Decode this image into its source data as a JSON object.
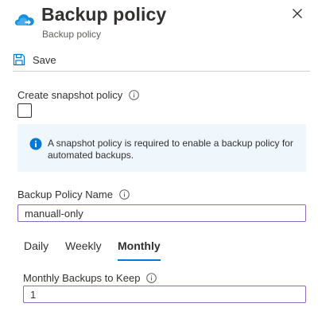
{
  "header": {
    "title": "Backup policy",
    "subtitle": "Backup policy",
    "app_icon": "cloud-backup-icon",
    "close_icon": "close-icon"
  },
  "toolbar": {
    "save_label": "Save",
    "save_icon": "save-icon"
  },
  "snapshot": {
    "label": "Create snapshot policy",
    "checked": false
  },
  "infobox": {
    "text": "A snapshot policy is required to enable a backup policy for automated backups.",
    "icon": "info-filled-icon"
  },
  "policy_name": {
    "label": "Backup Policy Name",
    "value": "manuall-only"
  },
  "tabs": [
    {
      "label": "Daily",
      "active": false
    },
    {
      "label": "Weekly",
      "active": false
    },
    {
      "label": "Monthly",
      "active": true
    }
  ],
  "monthly": {
    "label": "Monthly Backups to Keep",
    "value": "1"
  },
  "colors": {
    "accent": "#0078d4",
    "input_border": "#8a6bbd",
    "info_background": "#eff6fc",
    "text": "#323130"
  }
}
